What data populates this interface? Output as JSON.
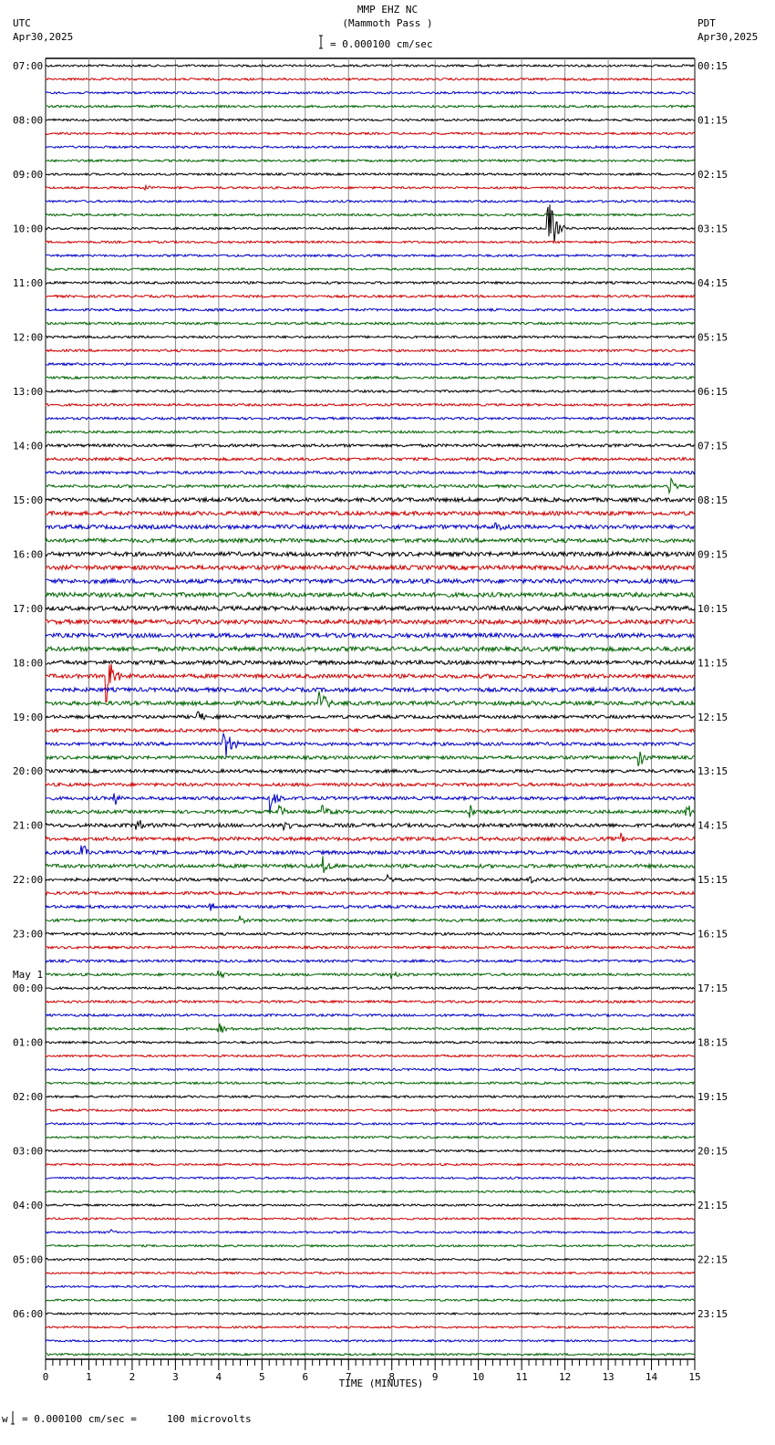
{
  "header": {
    "title": "MMP EHZ NC",
    "subtitle": "(Mammoth Pass )",
    "scale_label": "= 0.000100 cm/sec",
    "left_tz": "UTC",
    "left_date": "Apr30,2025",
    "right_tz": "PDT",
    "right_date": "Apr30,2025"
  },
  "footer": {
    "scale_note": "= 0.000100 cm/sec =     100 microvolts",
    "mark": "w"
  },
  "chart_data": {
    "type": "line",
    "subtype": "helicorder",
    "xlabel": "TIME (MINUTES)",
    "xlim": [
      0,
      15
    ],
    "xticks": [
      "0",
      "1",
      "2",
      "3",
      "4",
      "5",
      "6",
      "7",
      "8",
      "9",
      "10",
      "11",
      "12",
      "13",
      "14",
      "15"
    ],
    "trace_count": 96,
    "trace_minutes": 15,
    "trace_colors": [
      "#000000",
      "#d00000",
      "#0000c8",
      "#006400"
    ],
    "left_labels": [
      "07:00",
      "08:00",
      "09:00",
      "10:00",
      "11:00",
      "12:00",
      "13:00",
      "14:00",
      "15:00",
      "16:00",
      "17:00",
      "18:00",
      "19:00",
      "20:00",
      "21:00",
      "22:00",
      "23:00",
      "00:00",
      "01:00",
      "02:00",
      "03:00",
      "04:00",
      "05:00",
      "06:00"
    ],
    "date_change_label": "May 1",
    "right_labels": [
      "00:15",
      "01:15",
      "02:15",
      "03:15",
      "04:15",
      "05:15",
      "06:15",
      "07:15",
      "08:15",
      "09:15",
      "10:15",
      "11:15",
      "12:15",
      "13:15",
      "14:15",
      "15:15",
      "16:15",
      "17:15",
      "18:15",
      "19:15",
      "20:15",
      "21:15",
      "22:15",
      "23:15"
    ],
    "noise_by_hour": [
      1.2,
      1.2,
      1.2,
      1.2,
      1.3,
      1.3,
      1.3,
      1.6,
      2.2,
      2.4,
      2.4,
      2.2,
      1.8,
      1.8,
      2.0,
      1.6,
      1.4,
      1.3,
      1.2,
      1.2,
      1.1,
      1.1,
      1.1,
      1.1
    ],
    "events": [
      {
        "trace": 9,
        "minute": 2.3,
        "amplitude": 4
      },
      {
        "trace": 12,
        "minute": 11.6,
        "amplitude": 50
      },
      {
        "trace": 31,
        "minute": 14.4,
        "amplitude": 14
      },
      {
        "trace": 34,
        "minute": 10.4,
        "amplitude": 6
      },
      {
        "trace": 45,
        "minute": 1.4,
        "amplitude": 35
      },
      {
        "trace": 47,
        "minute": 6.3,
        "amplitude": 20
      },
      {
        "trace": 47,
        "minute": 8.9,
        "amplitude": 9
      },
      {
        "trace": 48,
        "minute": 3.5,
        "amplitude": 10
      },
      {
        "trace": 50,
        "minute": 4.1,
        "amplitude": 28
      },
      {
        "trace": 51,
        "minute": 13.7,
        "amplitude": 12
      },
      {
        "trace": 53,
        "minute": 14.0,
        "amplitude": 4
      },
      {
        "trace": 54,
        "minute": 1.6,
        "amplitude": 8
      },
      {
        "trace": 54,
        "minute": 5.2,
        "amplitude": 14
      },
      {
        "trace": 55,
        "minute": 5.4,
        "amplitude": 9
      },
      {
        "trace": 55,
        "minute": 6.4,
        "amplitude": 8
      },
      {
        "trace": 55,
        "minute": 9.8,
        "amplitude": 8
      },
      {
        "trace": 55,
        "minute": 14.8,
        "amplitude": 12
      },
      {
        "trace": 56,
        "minute": 2.1,
        "amplitude": 8
      },
      {
        "trace": 56,
        "minute": 5.5,
        "amplitude": 10
      },
      {
        "trace": 57,
        "minute": 13.3,
        "amplitude": 6
      },
      {
        "trace": 58,
        "minute": 0.8,
        "amplitude": 15
      },
      {
        "trace": 59,
        "minute": 6.4,
        "amplitude": 10
      },
      {
        "trace": 60,
        "minute": 7.9,
        "amplitude": 6
      },
      {
        "trace": 60,
        "minute": 11.2,
        "amplitude": 4
      },
      {
        "trace": 62,
        "minute": 3.8,
        "amplitude": 5
      },
      {
        "trace": 63,
        "minute": 4.5,
        "amplitude": 5
      },
      {
        "trace": 67,
        "minute": 4.0,
        "amplitude": 5
      },
      {
        "trace": 67,
        "minute": 8.0,
        "amplitude": 4
      },
      {
        "trace": 71,
        "minute": 4.0,
        "amplitude": 8
      },
      {
        "trace": 86,
        "minute": 1.5,
        "amplitude": 4
      }
    ]
  }
}
